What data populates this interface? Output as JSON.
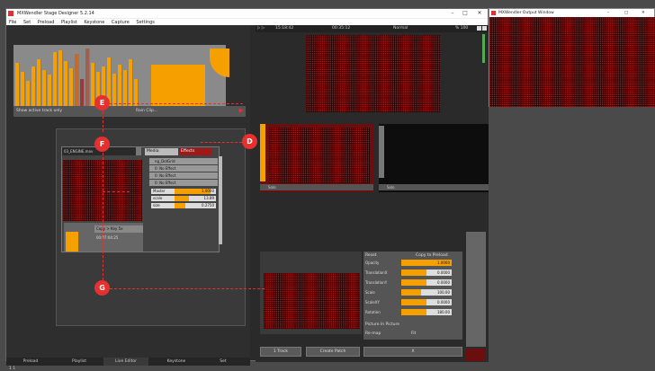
{
  "window": {
    "title": "MXWendler Stage Designer 5.2.14"
  },
  "menu": [
    "File",
    "Set",
    "Preload",
    "Playlist",
    "Keystone",
    "Capture",
    "Settings"
  ],
  "header": {
    "time_left": "15:18:42",
    "time_mid": "00:35:12",
    "mode": "Normal",
    "zoom": "% 100"
  },
  "clips": {
    "active_label": "Show active track only",
    "clip_name": "Rain Clip..."
  },
  "node": {
    "label": "03_ENGINE.mov"
  },
  "fx": {
    "tab_media": "Media",
    "tab_effects": "Effects",
    "items": [
      "ng_DotGrid",
      "0: No Effect",
      "0: No Effect",
      "0: No Effect"
    ],
    "sliders": [
      {
        "name": "Master",
        "value": "1.0000"
      },
      {
        "name": "scale",
        "value": "13.89"
      },
      {
        "name": "size",
        "value": "0.2750"
      }
    ],
    "copy_label": "Copy > Key 5x",
    "timecode": "00:07:04:25"
  },
  "annotations": {
    "d": "D",
    "e": "E",
    "f": "F",
    "g": "G"
  },
  "bottom_tabs": [
    "Preload",
    "Playlist",
    "Live Editor",
    "Keystone",
    "Set"
  ],
  "statusbar": "1 1",
  "layers": {
    "label_a": "Solo",
    "label_b": "Solo"
  },
  "props": {
    "reset": "Reset",
    "copy": "Copy to Preload",
    "rows": [
      {
        "name": "Opacity",
        "value": "1.0000",
        "fill": 1.0
      },
      {
        "name": "TranslationX",
        "value": "0.0000",
        "fill": 0.5
      },
      {
        "name": "TranslationY",
        "value": "0.0000",
        "fill": 0.5
      },
      {
        "name": "Scale",
        "value": "100.00",
        "fill": 0.4
      },
      {
        "name": "ScaleXY",
        "value": "0.0000",
        "fill": 0.5
      },
      {
        "name": "Rotation",
        "value": "180.00",
        "fill": 0.5
      }
    ],
    "pip": "Picture In Picture",
    "remap": "Re-map",
    "remap_mode": "Fit"
  },
  "buttons": {
    "track": "1 Track",
    "patch": "Create Patch",
    "x": "X"
  },
  "output": {
    "title": "MXWendler Output Window"
  },
  "colors": {
    "accent": "#f5a000",
    "annotation": "#e53030"
  }
}
